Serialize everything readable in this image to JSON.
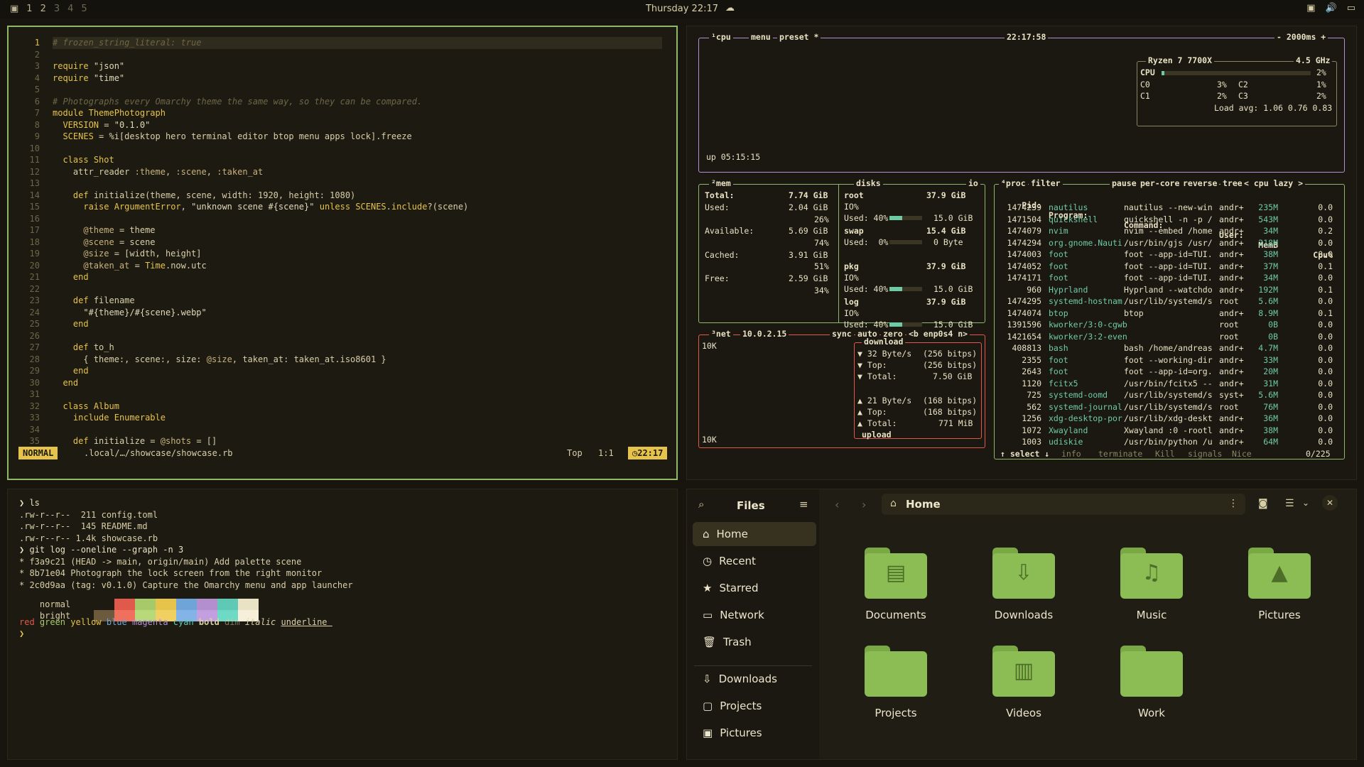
{
  "topbar": {
    "workspaces": [
      "1",
      "2",
      "3",
      "4",
      "5"
    ],
    "clock": "Thursday 22:17",
    "weather_icon": "cloud-icon",
    "tray_icons": [
      "screen-icon",
      "volume-icon",
      "display-icon"
    ]
  },
  "editor": {
    "lines": [
      {
        "n": "1",
        "t": "# frozen_string_literal: true"
      },
      {
        "n": "2",
        "t": ""
      },
      {
        "n": "3",
        "t": "require \"json\""
      },
      {
        "n": "4",
        "t": "require \"time\""
      },
      {
        "n": "5",
        "t": ""
      },
      {
        "n": "6",
        "t": "# Photographs every Omarchy theme the same way, so they can be compared."
      },
      {
        "n": "7",
        "t": "module ThemePhotograph"
      },
      {
        "n": "8",
        "t": "  VERSION = \"0.1.0\""
      },
      {
        "n": "9",
        "t": "  SCENES = %i[desktop hero terminal editor btop menu apps lock].freeze"
      },
      {
        "n": "10",
        "t": ""
      },
      {
        "n": "11",
        "t": "  class Shot"
      },
      {
        "n": "12",
        "t": "    attr_reader :theme, :scene, :taken_at"
      },
      {
        "n": "13",
        "t": ""
      },
      {
        "n": "14",
        "t": "    def initialize(theme, scene, width: 1920, height: 1080)"
      },
      {
        "n": "15",
        "t": "      raise ArgumentError, \"unknown scene #{scene}\" unless SCENES.include?(scene)"
      },
      {
        "n": "16",
        "t": ""
      },
      {
        "n": "17",
        "t": "      @theme = theme"
      },
      {
        "n": "18",
        "t": "      @scene = scene"
      },
      {
        "n": "19",
        "t": "      @size = [width, height]"
      },
      {
        "n": "20",
        "t": "      @taken_at = Time.now.utc"
      },
      {
        "n": "21",
        "t": "    end"
      },
      {
        "n": "22",
        "t": ""
      },
      {
        "n": "23",
        "t": "    def filename"
      },
      {
        "n": "24",
        "t": "      \"#{theme}/#{scene}.webp\""
      },
      {
        "n": "25",
        "t": "    end"
      },
      {
        "n": "26",
        "t": ""
      },
      {
        "n": "27",
        "t": "    def to_h"
      },
      {
        "n": "28",
        "t": "      { theme:, scene:, size: @size, taken_at: taken_at.iso8601 }"
      },
      {
        "n": "29",
        "t": "    end"
      },
      {
        "n": "30",
        "t": "  end"
      },
      {
        "n": "31",
        "t": ""
      },
      {
        "n": "32",
        "t": "  class Album"
      },
      {
        "n": "33",
        "t": "    include Enumerable"
      },
      {
        "n": "34",
        "t": ""
      },
      {
        "n": "35",
        "t": "    def initialize = @shots = []"
      }
    ],
    "status": {
      "mode": "NORMAL",
      "path": ".local/…/showcase/showcase.rb",
      "position": "Top",
      "linecol": "1:1",
      "time": "22:17"
    }
  },
  "btop": {
    "cpu": {
      "title": "¹cpu",
      "menu": "menu",
      "preset": "preset *",
      "clock": "22:17:58",
      "interval": "- 2000ms +",
      "uptime": "up 05:15:15",
      "model": "Ryzen 7 7700X",
      "freq": "4.5 GHz",
      "total_label": "CPU",
      "total_pct": "2%",
      "total_value": 0.02,
      "cores": [
        {
          "name": "C0",
          "pct": "3%"
        },
        {
          "name": "C2",
          "pct": "1%"
        },
        {
          "name": "C1",
          "pct": "2%"
        },
        {
          "name": "C3",
          "pct": "2%"
        }
      ],
      "load": "Load avg: 1.06 0.76 0.83"
    },
    "mem": {
      "title": "²mem",
      "total": "7.74 GiB",
      "used": "2.04 GiB",
      "used_pct": "26%",
      "available": "5.69 GiB",
      "avail_pct": "74%",
      "cached": "3.91 GiB",
      "cached_pct": "51%",
      "free": "2.59 GiB",
      "free_pct": "34%"
    },
    "disks": {
      "title": "disks",
      "io": "io",
      "items": [
        {
          "name": "root",
          "size": "37.9 GiB",
          "io": "IO%",
          "used_label": "Used: 40%",
          "used": "15.0 GiB",
          "pct": 0.4
        },
        {
          "name": "swap",
          "size": "15.4 GiB",
          "io": "",
          "used_label": "Used:  0%",
          "used": "0 Byte",
          "pct": 0.0
        },
        {
          "name": "pkg",
          "size": "37.9 GiB",
          "io": "IO%",
          "used_label": "Used: 40%",
          "used": "15.0 GiB",
          "pct": 0.4
        },
        {
          "name": "log",
          "size": "37.9 GiB",
          "io": "IO%",
          "used_label": "Used: 40%",
          "used": "15.0 GiB",
          "pct": 0.4
        }
      ]
    },
    "net": {
      "title": "³net",
      "ip": "10.0.2.15",
      "sync": "sync",
      "auto": "auto",
      "zero": "zero",
      "iface": "<b enp0s4 n>",
      "scale_top": "10K",
      "scale_bottom": "10K",
      "download": "download",
      "dl_rate": "▼ 32 Byte/s",
      "dl_bits": "(256 bitps)",
      "dl_top": "▼ Top:",
      "dl_top_bits": "(256 bitps)",
      "dl_total": "▼ Total:",
      "dl_total_val": "7.50 GiB",
      "ul_rate": "▲ 21 Byte/s",
      "ul_bits": "(168 bitps)",
      "ul_top": "▲ Top:",
      "ul_top_bits": "(168 bitps)",
      "ul_total": "▲ Total:",
      "ul_total_val": "771 MiB",
      "upload": "upload"
    },
    "proc": {
      "title": "⁴proc",
      "filter": "filter",
      "pause": "pause",
      "percore": "per-core",
      "reverse": "reverse",
      "tree": "tree",
      "sort": "< cpu lazy >",
      "headers": {
        "pid": "Pid:",
        "program": "Program:",
        "command": "Command:",
        "user": "User:",
        "mem": "MemB",
        "cpu": "Cpu%"
      },
      "rows": [
        {
          "pid": "1474239",
          "prg": "nautilus",
          "cmd": "nautilus --new-win",
          "usr": "andr+",
          "mem": "235M",
          "cpu": "0.0"
        },
        {
          "pid": "1471504",
          "prg": "quickshell",
          "cmd": "quickshell -n -p /",
          "usr": "andr+",
          "mem": "543M",
          "cpu": "0.0"
        },
        {
          "pid": "1474079",
          "prg": "nvim",
          "cmd": "nvim --embed /home",
          "usr": "andr+",
          "mem": "34M",
          "cpu": "0.2"
        },
        {
          "pid": "1474294",
          "prg": "org.gnome.Nauti",
          "cmd": "/usr/bin/gjs /usr/",
          "usr": "andr+",
          "mem": "218M",
          "cpu": "0.0"
        },
        {
          "pid": "1474003",
          "prg": "foot",
          "cmd": "foot --app-id=TUI.",
          "usr": "andr+",
          "mem": "38M",
          "cpu": "0.0"
        },
        {
          "pid": "1474052",
          "prg": "foot",
          "cmd": "foot --app-id=TUI.",
          "usr": "andr+",
          "mem": "37M",
          "cpu": "0.1"
        },
        {
          "pid": "1474171",
          "prg": "foot",
          "cmd": "foot --app-id=TUI.",
          "usr": "andr+",
          "mem": "34M",
          "cpu": "0.0"
        },
        {
          "pid": "960",
          "prg": "Hyprland",
          "cmd": "Hyprland --watchdo",
          "usr": "andr+",
          "mem": "192M",
          "cpu": "0.1"
        },
        {
          "pid": "1474295",
          "prg": "systemd-hostnam",
          "cmd": "/usr/lib/systemd/s",
          "usr": "root",
          "mem": "5.6M",
          "cpu": "0.0"
        },
        {
          "pid": "1474074",
          "prg": "btop",
          "cmd": "btop",
          "usr": "andr+",
          "mem": "8.9M",
          "cpu": "0.1"
        },
        {
          "pid": "1391596",
          "prg": "kworker/3:0-cgwb",
          "cmd": "",
          "usr": "root",
          "mem": "0B",
          "cpu": "0.0"
        },
        {
          "pid": "1421654",
          "prg": "kworker/3:2-even",
          "cmd": "",
          "usr": "root",
          "mem": "0B",
          "cpu": "0.0"
        },
        {
          "pid": "408813",
          "prg": "bash",
          "cmd": "bash /home/andreas",
          "usr": "andr+",
          "mem": "4.7M",
          "cpu": "0.0"
        },
        {
          "pid": "2355",
          "prg": "foot",
          "cmd": "foot --working-dir",
          "usr": "andr+",
          "mem": "33M",
          "cpu": "0.0"
        },
        {
          "pid": "2643",
          "prg": "foot",
          "cmd": "foot --app-id=org.",
          "usr": "andr+",
          "mem": "20M",
          "cpu": "0.0"
        },
        {
          "pid": "1120",
          "prg": "fcitx5",
          "cmd": "/usr/bin/fcitx5 --",
          "usr": "andr+",
          "mem": "31M",
          "cpu": "0.0"
        },
        {
          "pid": "725",
          "prg": "systemd-oomd",
          "cmd": "/usr/lib/systemd/s",
          "usr": "syst+",
          "mem": "5.6M",
          "cpu": "0.0"
        },
        {
          "pid": "562",
          "prg": "systemd-journal",
          "cmd": "/usr/lib/systemd/s",
          "usr": "root",
          "mem": "76M",
          "cpu": "0.0"
        },
        {
          "pid": "1256",
          "prg": "xdg-desktop-por",
          "cmd": "/usr/lib/xdg-deskt",
          "usr": "andr+",
          "mem": "36M",
          "cpu": "0.0"
        },
        {
          "pid": "1072",
          "prg": "Xwayland",
          "cmd": "Xwayland :0 -rootl",
          "usr": "andr+",
          "mem": "38M",
          "cpu": "0.0"
        },
        {
          "pid": "1003",
          "prg": "udiskie",
          "cmd": "/usr/bin/python /u",
          "usr": "andr+",
          "mem": "64M",
          "cpu": "0.0"
        }
      ],
      "footer": {
        "select": "↑ select ↓",
        "info": "info",
        "terminate": "terminate",
        "kill": "Kill",
        "signals": "signals",
        "nice": "Nice",
        "count": "0/225"
      }
    }
  },
  "terminal": {
    "lines": [
      "❯ ls",
      ".rw-r--r--  211 config.toml",
      ".rw-r--r--  145 README.md",
      ".rw-r--r-- 1.4k showcase.rb",
      "❯ git log --oneline --graph -n 3",
      "* f3a9c21 (HEAD -> main, origin/main) Add palette scene",
      "* 8b71e04 Photograph the lock screen from the right monitor",
      "* 2c0d9aa (tag: v0.1.0) Capture the Omarchy menu and app launcher"
    ],
    "palette_normal_label": "normal",
    "palette_bright_label": "bright",
    "palette_normal": [
      "#1d1a12",
      "#e0594a",
      "#a7c96a",
      "#e6c34a",
      "#6fa4d8",
      "#b48fd0",
      "#5ec9b4",
      "#e9e2c4"
    ],
    "palette_bright": [
      "#6b5a3c",
      "#f0705e",
      "#b7d97a",
      "#f0d060",
      "#82b4e8",
      "#c49fe0",
      "#6ed9c4",
      "#f6f0da"
    ],
    "styles": [
      "red",
      "green",
      "yellow",
      "blue",
      "magenta",
      "cyan",
      "bold",
      "dim",
      "italic",
      "underline"
    ],
    "prompt": "❯"
  },
  "files": {
    "sidebar_title": "Files",
    "location": "Home",
    "sidebar": [
      {
        "label": "Home",
        "icon": "home-icon",
        "glyph": "⌂",
        "active": true
      },
      {
        "label": "Recent",
        "icon": "clock-icon",
        "glyph": "◷"
      },
      {
        "label": "Starred",
        "icon": "star-icon",
        "glyph": "★"
      },
      {
        "label": "Network",
        "icon": "network-icon",
        "glyph": "▭"
      },
      {
        "label": "Trash",
        "icon": "trash-icon",
        "glyph": "🗑"
      },
      {
        "label": "Downloads",
        "icon": "download-icon",
        "glyph": "⇩"
      },
      {
        "label": "Projects",
        "icon": "folder-icon",
        "glyph": "▢"
      },
      {
        "label": "Pictures",
        "icon": "picture-icon",
        "glyph": "▣"
      }
    ],
    "folders": [
      {
        "label": "Documents",
        "icon": "documents-folder-icon",
        "glyph": "▤"
      },
      {
        "label": "Downloads",
        "icon": "downloads-folder-icon",
        "glyph": "⇩"
      },
      {
        "label": "Music",
        "icon": "music-folder-icon",
        "glyph": "♫"
      },
      {
        "label": "Pictures",
        "icon": "pictures-folder-icon",
        "glyph": "▲"
      },
      {
        "label": "Projects",
        "icon": "projects-folder-icon",
        "glyph": ""
      },
      {
        "label": "Videos",
        "icon": "videos-folder-icon",
        "glyph": "▥"
      },
      {
        "label": "Work",
        "icon": "work-folder-icon",
        "glyph": ""
      }
    ]
  }
}
